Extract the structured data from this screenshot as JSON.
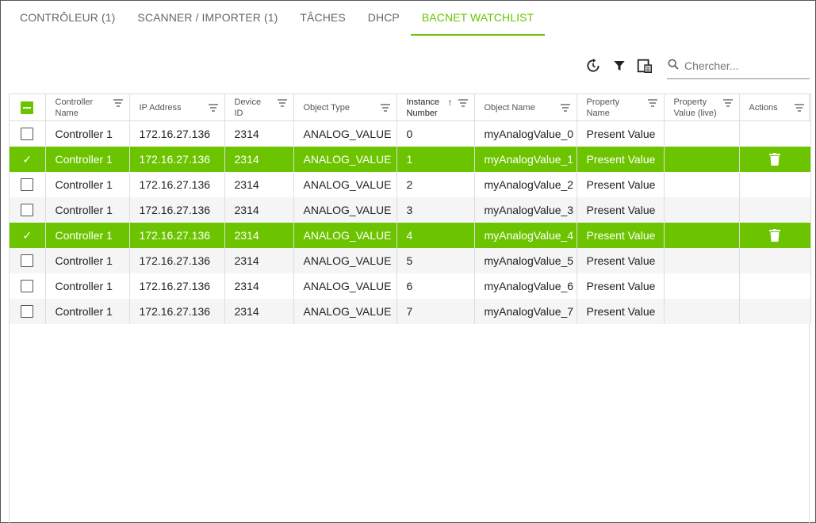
{
  "tabs": [
    {
      "label": "CONTRÔLEUR (1)",
      "active": false
    },
    {
      "label": "SCANNER / IMPORTER (1)",
      "active": false
    },
    {
      "label": "TÂCHES",
      "active": false
    },
    {
      "label": "DHCP",
      "active": false
    },
    {
      "label": "BACNET WATCHLIST",
      "active": true
    }
  ],
  "toolbar": {
    "refresh_icon": "refresh-icon",
    "filter_icon": "filter-icon",
    "export_icon": "export-icon"
  },
  "search": {
    "placeholder": "Chercher...",
    "value": ""
  },
  "colors": {
    "accent": "#6cc400"
  },
  "table": {
    "columns": [
      {
        "line1": "Controller",
        "line2": "Name"
      },
      {
        "line1": "IP Address",
        "line2": ""
      },
      {
        "line1": "Device",
        "line2": "ID"
      },
      {
        "line1": "Object Type",
        "line2": ""
      },
      {
        "line1": "Instance",
        "line2": "Number",
        "sorted": "asc"
      },
      {
        "line1": "Object Name",
        "line2": ""
      },
      {
        "line1": "Property",
        "line2": "Name"
      },
      {
        "line1": "Property",
        "line2": "Value (live)"
      },
      {
        "line1": "Actions",
        "line2": ""
      }
    ],
    "header_checkbox": "indeterminate",
    "rows": [
      {
        "selected": false,
        "controller": "Controller 1",
        "ip": "172.16.27.136",
        "device_id": "2314",
        "object_type": "ANALOG_VALUE",
        "instance": "0",
        "object_name": "myAnalogValue_0",
        "property": "Present Value",
        "value": ""
      },
      {
        "selected": true,
        "controller": "Controller 1",
        "ip": "172.16.27.136",
        "device_id": "2314",
        "object_type": "ANALOG_VALUE",
        "instance": "1",
        "object_name": "myAnalogValue_1",
        "property": "Present Value",
        "value": ""
      },
      {
        "selected": false,
        "controller": "Controller 1",
        "ip": "172.16.27.136",
        "device_id": "2314",
        "object_type": "ANALOG_VALUE",
        "instance": "2",
        "object_name": "myAnalogValue_2",
        "property": "Present Value",
        "value": ""
      },
      {
        "selected": false,
        "controller": "Controller 1",
        "ip": "172.16.27.136",
        "device_id": "2314",
        "object_type": "ANALOG_VALUE",
        "instance": "3",
        "object_name": "myAnalogValue_3",
        "property": "Present Value",
        "value": ""
      },
      {
        "selected": true,
        "controller": "Controller 1",
        "ip": "172.16.27.136",
        "device_id": "2314",
        "object_type": "ANALOG_VALUE",
        "instance": "4",
        "object_name": "myAnalogValue_4",
        "property": "Present Value",
        "value": ""
      },
      {
        "selected": false,
        "controller": "Controller 1",
        "ip": "172.16.27.136",
        "device_id": "2314",
        "object_type": "ANALOG_VALUE",
        "instance": "5",
        "object_name": "myAnalogValue_5",
        "property": "Present Value",
        "value": ""
      },
      {
        "selected": false,
        "controller": "Controller 1",
        "ip": "172.16.27.136",
        "device_id": "2314",
        "object_type": "ANALOG_VALUE",
        "instance": "6",
        "object_name": "myAnalogValue_6",
        "property": "Present Value",
        "value": ""
      },
      {
        "selected": false,
        "controller": "Controller 1",
        "ip": "172.16.27.136",
        "device_id": "2314",
        "object_type": "ANALOG_VALUE",
        "instance": "7",
        "object_name": "myAnalogValue_7",
        "property": "Present Value",
        "value": ""
      }
    ]
  }
}
